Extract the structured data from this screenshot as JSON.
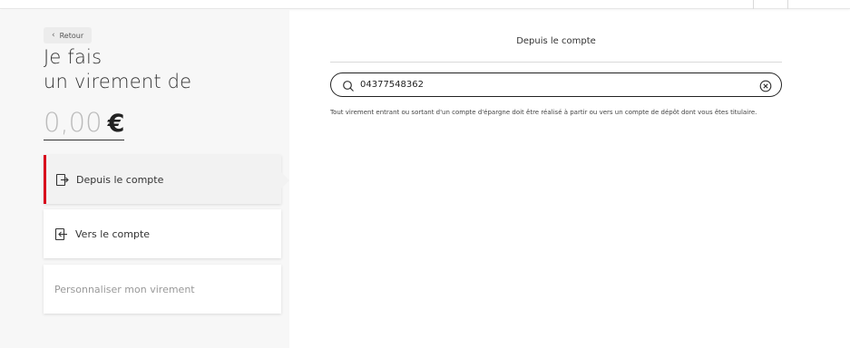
{
  "back": {
    "label": "Retour"
  },
  "title": {
    "line1": "Je fais",
    "line2": "un virement de"
  },
  "amount": {
    "value": "0,00",
    "currency": "€"
  },
  "cards": {
    "from": {
      "label": "Depuis le compte",
      "active": true
    },
    "to": {
      "label": "Vers le compte"
    },
    "custom": {
      "label": "Personnaliser mon virement"
    }
  },
  "main": {
    "heading": "Depuis le compte",
    "search": {
      "value": "04377548362",
      "placeholder": ""
    },
    "info": "Tout virement entrant ou sortant d'un compte d'épargne doit être réalisé à partir ou vers un compte de dépôt dont vous êtes titulaire."
  },
  "colors": {
    "accent": "#d8031c",
    "panel": "#f7f7f7"
  },
  "icons": {
    "from": "account-out-icon",
    "to": "account-in-icon",
    "search": "search-icon",
    "clear": "clear-icon"
  }
}
